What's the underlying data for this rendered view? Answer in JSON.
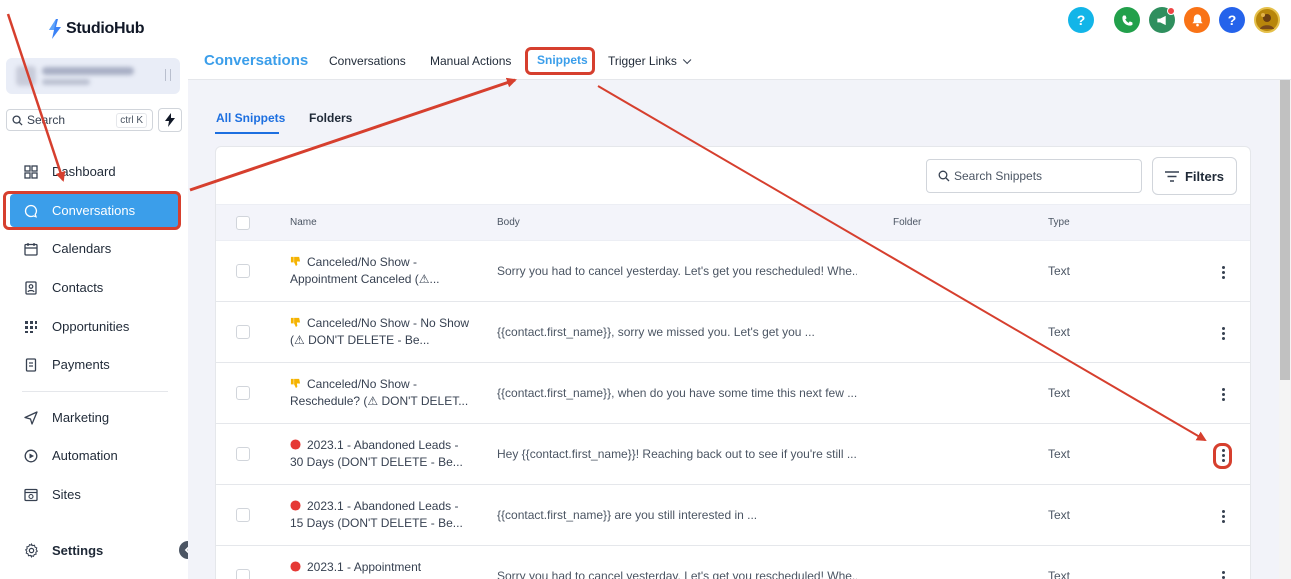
{
  "app": {
    "logo": "StudioHub"
  },
  "sidebar": {
    "search_label": "Search",
    "search_shortcut": "ctrl K",
    "items": [
      {
        "label": "Dashboard",
        "icon": "dashboard-icon"
      },
      {
        "label": "Conversations",
        "icon": "chat-bubble-icon"
      },
      {
        "label": "Calendars",
        "icon": "calendar-icon"
      },
      {
        "label": "Contacts",
        "icon": "contacts-icon"
      },
      {
        "label": "Opportunities",
        "icon": "opportunities-icon"
      },
      {
        "label": "Payments",
        "icon": "payments-icon"
      },
      {
        "label": "Marketing",
        "icon": "send-icon"
      },
      {
        "label": "Automation",
        "icon": "automation-icon"
      },
      {
        "label": "Sites",
        "icon": "sites-icon"
      },
      {
        "label": "Settings",
        "icon": "gear-icon"
      }
    ]
  },
  "header": {
    "section_title": "Conversations",
    "tabs": [
      "Conversations",
      "Manual Actions",
      "Snippets",
      "Trigger Links"
    ],
    "active_tab": "Snippets"
  },
  "snippets": {
    "tabs": [
      "All Snippets",
      "Folders"
    ],
    "search_placeholder": "Search Snippets",
    "filters_label": "Filters",
    "columns": [
      "Name",
      "Body",
      "Folder",
      "Type"
    ],
    "rows": [
      {
        "emoji": "thumbs-down",
        "name": "Canceled/No Show - Appointment Canceled (⚠...",
        "body": "Sorry you had to cancel yesterday. Let's get you rescheduled! Whe...",
        "folder": "",
        "type": "Text"
      },
      {
        "emoji": "thumbs-down",
        "name": "Canceled/No Show - No Show (⚠ DON'T DELETE - Be...",
        "body": "{{contact.first_name}}, sorry we missed you. Let's get you ...",
        "folder": "",
        "type": "Text"
      },
      {
        "emoji": "thumbs-down",
        "name": "Canceled/No Show - Reschedule? (⚠ DON'T DELET...",
        "body": "{{contact.first_name}}, when do you have some time this next few ...",
        "folder": "",
        "type": "Text"
      },
      {
        "emoji": "red-circle",
        "name": "2023.1 - Abandoned Leads - 30 Days (DON'T DELETE - Be...",
        "body": "Hey {{contact.first_name}}! Reaching back out to see if you're still ...",
        "folder": "",
        "type": "Text"
      },
      {
        "emoji": "red-circle",
        "name": "2023.1 - Abandoned Leads - 15 Days (DON'T DELETE - Be...",
        "body": "{{contact.first_name}} are you still interested in ...",
        "folder": "",
        "type": "Text"
      },
      {
        "emoji": "red-circle",
        "name": "2023.1 - Appointment",
        "body": "Sorry you had to cancel yesterday. Let's get you rescheduled! Whe...",
        "folder": "",
        "type": "Text"
      }
    ]
  },
  "colors": {
    "accent": "#3b9eea",
    "annotation": "#d63f2e"
  }
}
